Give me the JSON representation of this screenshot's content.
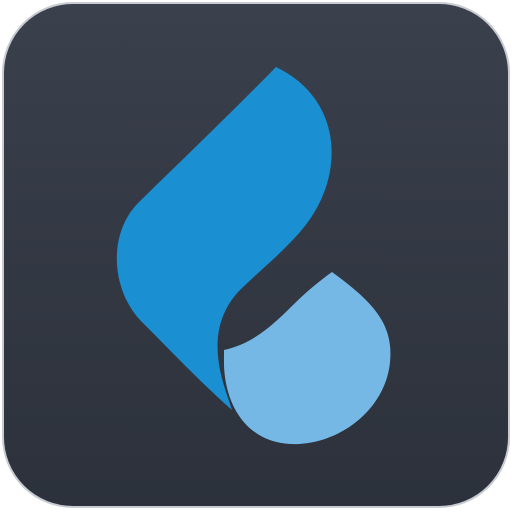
{
  "icon": {
    "name": "water-drop-logo",
    "tile_color_top": "#3a404c",
    "tile_color_bottom": "#2c313b",
    "primary_color": "#1a8fd1",
    "secondary_color": "#75b8e6",
    "border_color": "#c8cbd0"
  }
}
